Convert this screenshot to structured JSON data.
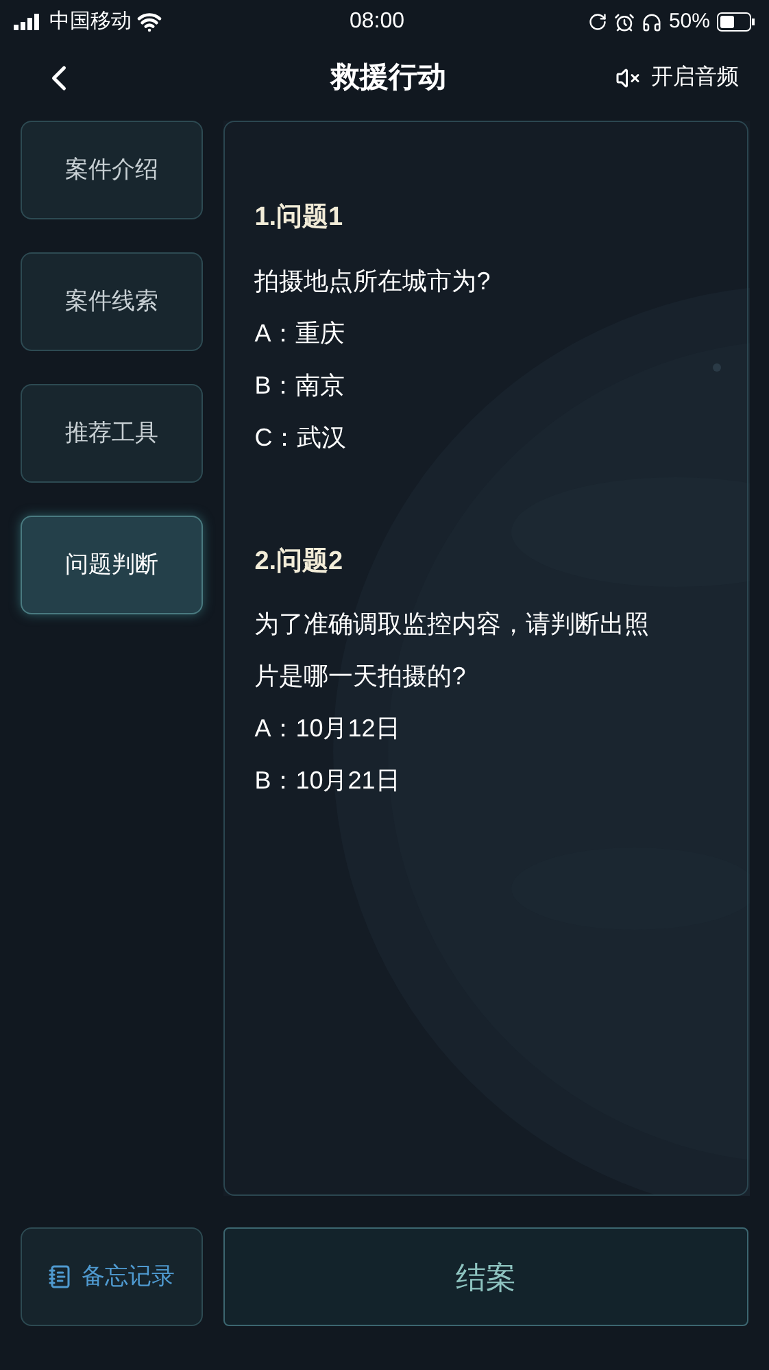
{
  "status_bar": {
    "carrier": "中国移动",
    "time": "08:00",
    "battery": "50%"
  },
  "header": {
    "title": "救援行动",
    "audio_label": "开启音频"
  },
  "sidebar": {
    "items": [
      {
        "label": "案件介绍",
        "selected": false
      },
      {
        "label": "案件线索",
        "selected": false
      },
      {
        "label": "推荐工具",
        "selected": false
      },
      {
        "label": "问题判断",
        "selected": true
      }
    ]
  },
  "questions": [
    {
      "title": "1.问题1",
      "text": "拍摄地点所在城市为?",
      "options": [
        "A：重庆",
        "B：南京",
        "C：武汉"
      ]
    },
    {
      "title": "2.问题2",
      "text": "为了准确调取监控内容，请判断出照片是哪一天拍摄的?",
      "options": [
        "A：10月12日",
        "B：10月21日"
      ]
    }
  ],
  "footer": {
    "memo_label": "备忘记录",
    "close_case_label": "结案"
  }
}
